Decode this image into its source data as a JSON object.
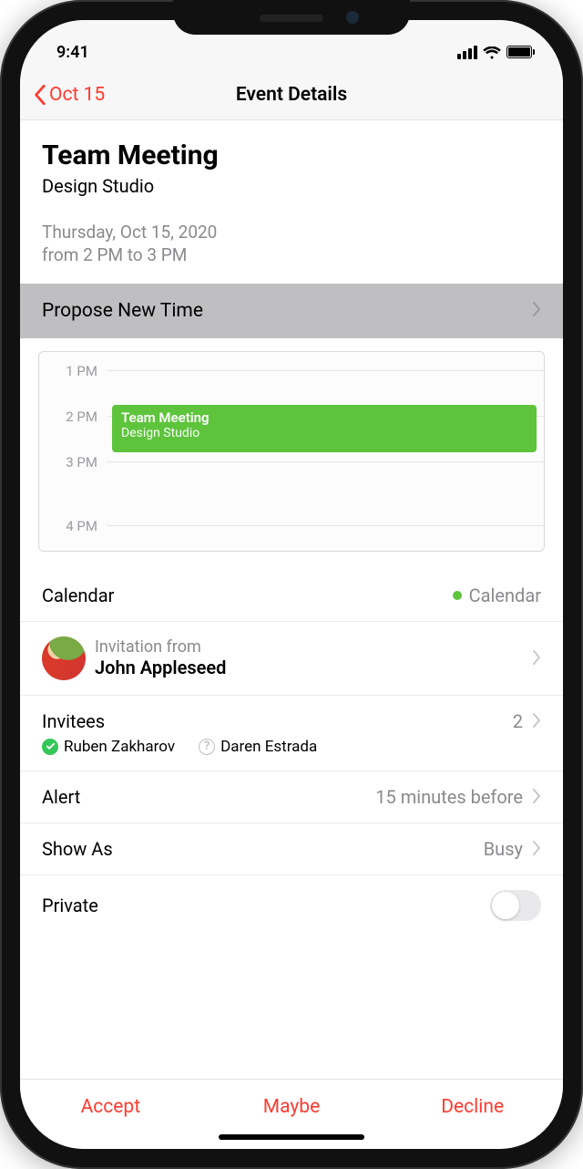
{
  "status": {
    "time": "9:41"
  },
  "nav": {
    "back": "Oct 15",
    "title": "Event Details"
  },
  "event": {
    "title": "Team Meeting",
    "location": "Design Studio",
    "date_line": "Thursday, Oct 15, 2020",
    "time_line": "from 2 PM to 3 PM"
  },
  "propose": {
    "label": "Propose New Time"
  },
  "timeline": {
    "hours": [
      "1 PM",
      "2 PM",
      "3 PM",
      "4 PM"
    ],
    "block": {
      "title": "Team Meeting",
      "subtitle": "Design Studio"
    }
  },
  "calendar_row": {
    "label": "Calendar",
    "value": "Calendar"
  },
  "invitation": {
    "from_label": "Invitation from",
    "name": "John Appleseed"
  },
  "invitees": {
    "label": "Invitees",
    "count": "2",
    "list": [
      {
        "name": "Ruben Zakharov",
        "status": "accepted"
      },
      {
        "name": "Daren Estrada",
        "status": "tentative"
      }
    ]
  },
  "alert": {
    "label": "Alert",
    "value": "15 minutes before"
  },
  "show_as": {
    "label": "Show As",
    "value": "Busy"
  },
  "private_row": {
    "label": "Private",
    "value": false
  },
  "rsvp": {
    "accept": "Accept",
    "maybe": "Maybe",
    "decline": "Decline"
  }
}
